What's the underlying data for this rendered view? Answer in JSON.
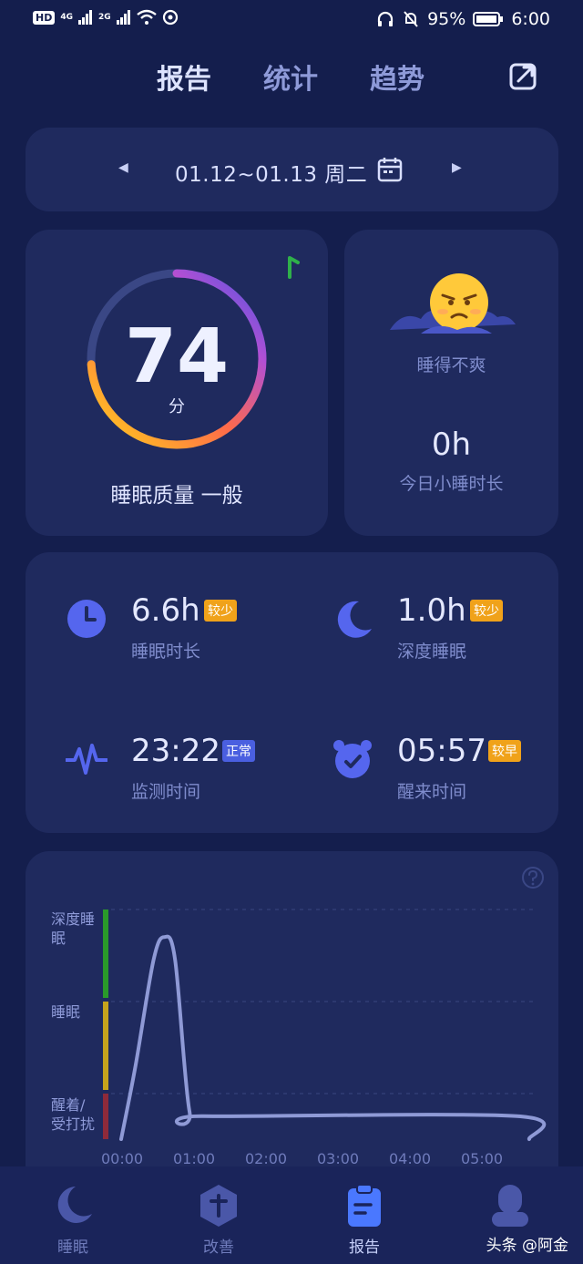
{
  "status_bar": {
    "hd": "HD",
    "sig1": "4G",
    "sig2": "2G",
    "battery_pct": "95%",
    "time": "6:00"
  },
  "tabs": [
    {
      "label": "报告",
      "active": true
    },
    {
      "label": "统计",
      "active": false
    },
    {
      "label": "趋势",
      "active": false
    }
  ],
  "date_card": {
    "range": "01.12~01.13 周二",
    "prev_icon": "◀",
    "next_icon": "▶"
  },
  "score_card": {
    "score": "74",
    "unit": "分",
    "quality": "睡眠质量 一般",
    "score_fraction": 0.74
  },
  "nap_card": {
    "mood": "睡得不爽",
    "nap_value": "0h",
    "nap_label": "今日小睡时长"
  },
  "stats": [
    {
      "value": "6.6h",
      "badge": "较少",
      "badge_color": "#f0a21a",
      "label": "睡眠时长",
      "icon": "clock-icon"
    },
    {
      "value": "1.0h",
      "badge": "较少",
      "badge_color": "#f0a21a",
      "label": "深度睡眠",
      "icon": "moon-icon"
    },
    {
      "value": "23:22",
      "badge": "正常",
      "badge_color": "#4a5fe0",
      "label": "监测时间",
      "icon": "heartbeat-icon"
    },
    {
      "value": "05:57",
      "badge": "较早",
      "badge_color": "#f0a21a",
      "label": "醒来时间",
      "icon": "alarm-clock-icon"
    }
  ],
  "chart_data": {
    "type": "line",
    "y_levels": [
      "醒着/受打扰",
      "睡眠",
      "深度睡眠"
    ],
    "y_labels_display": [
      "深度睡\n眠",
      "睡眠",
      "醒着/\n受打扰"
    ],
    "x_ticks": [
      "00:00",
      "01:00",
      "02:00",
      "03:00",
      "04:00",
      "05:00"
    ],
    "series": [
      {
        "x": [
          0.0,
          0.2,
          0.45,
          0.6,
          0.75,
          0.95,
          1.15,
          5.5,
          5.67
        ],
        "values": [
          0.0,
          0.8,
          1.95,
          2.2,
          1.95,
          0.3,
          0.25,
          0.25,
          0.0
        ]
      }
    ],
    "level_colors": [
      "#8e2a3a",
      "#c6a31c",
      "#2a9a2a"
    ],
    "grid": true
  },
  "bottom_nav": [
    {
      "label": "睡眠",
      "icon": "moon-icon",
      "active": false
    },
    {
      "label": "改善",
      "icon": "improve-icon",
      "active": false
    },
    {
      "label": "报告",
      "icon": "clipboard-icon",
      "active": true
    },
    {
      "label": "",
      "icon": "profile-icon",
      "active": false
    }
  ],
  "watermark": "头条 @阿金",
  "colors": {
    "background": "#141e4d",
    "card": "#1f2a5e",
    "accent": "#5566ee",
    "muted_text": "#7f8ccc"
  }
}
